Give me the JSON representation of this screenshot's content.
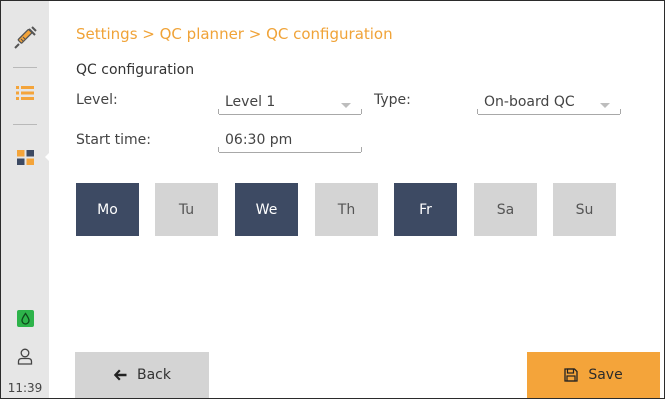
{
  "sidebar": {
    "icons": [
      "syringe-icon",
      "list-icon",
      "grid-icon",
      "drop-status-icon",
      "user-icon"
    ],
    "time": "11:39",
    "active_item": "grid-icon"
  },
  "header": {
    "breadcrumb": "Settings > QC planner > QC configuration"
  },
  "form": {
    "title": "QC configuration",
    "level_label": "Level:",
    "level_value": "Level 1",
    "type_label": "Type:",
    "type_value": "On-board QC",
    "start_time_label": "Start time:",
    "start_time_value": "06:30 pm"
  },
  "days": [
    {
      "label": "Mo",
      "selected": true
    },
    {
      "label": "Tu",
      "selected": false
    },
    {
      "label": "We",
      "selected": true
    },
    {
      "label": "Th",
      "selected": false
    },
    {
      "label": "Fr",
      "selected": true
    },
    {
      "label": "Sa",
      "selected": false
    },
    {
      "label": "Su",
      "selected": false
    }
  ],
  "footer": {
    "back_label": "Back",
    "save_label": "Save"
  },
  "colors": {
    "accent": "#f4a43a",
    "breadcrumb": "#f0a338",
    "day_selected": "#3d4a63",
    "day_unselected": "#d4d4d4",
    "sidebar_bg": "#e6e6e6",
    "status_green": "#2db34a"
  }
}
